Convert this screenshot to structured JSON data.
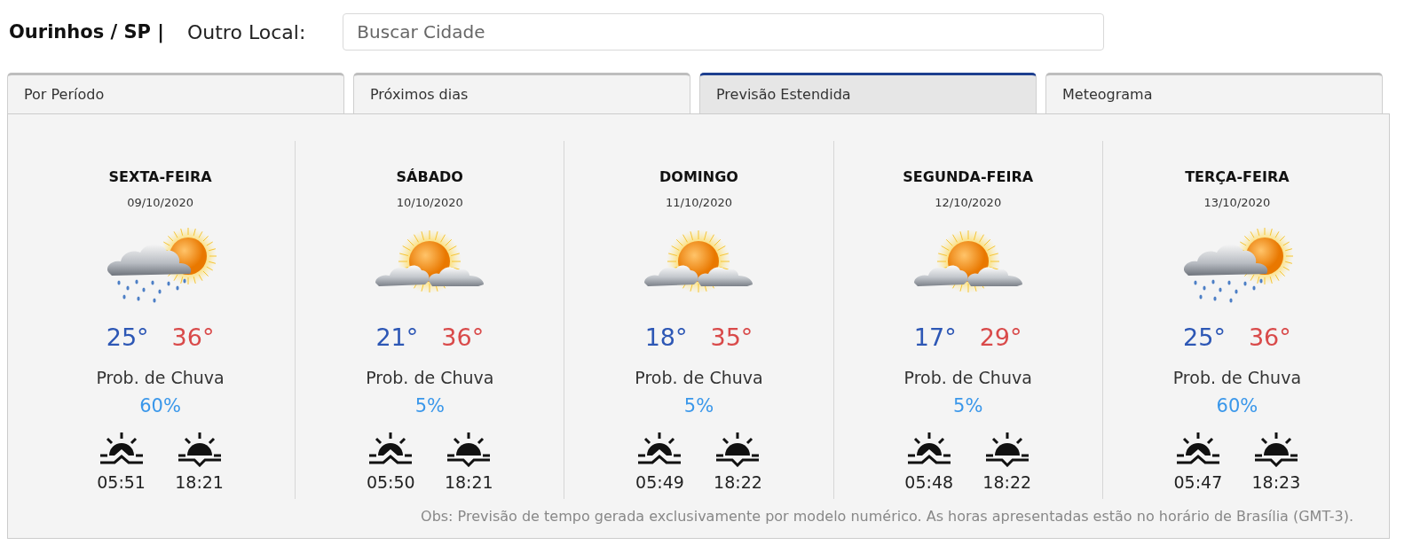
{
  "header": {
    "title": "Ourinhos / SP |",
    "label": "Outro Local:"
  },
  "search": {
    "placeholder": "Buscar Cidade"
  },
  "tabs": [
    {
      "label": "Por Período",
      "selected": false
    },
    {
      "label": "Próximos dias",
      "selected": false
    },
    {
      "label": "Previsão Estendida",
      "selected": true
    },
    {
      "label": "Meteograma",
      "selected": false
    }
  ],
  "days": [
    {
      "name": "SEXTA-FEIRA",
      "date": "09/10/2020",
      "kind": "rain",
      "min": "25°",
      "max": "36°",
      "rain_label": "Prob. de Chuva",
      "rain_chance": "60%",
      "sunrise": "05:51",
      "sunset": "18:21"
    },
    {
      "name": "SÁBADO",
      "date": "10/10/2020",
      "kind": "cloudy",
      "min": "21°",
      "max": "36°",
      "rain_label": "Prob. de Chuva",
      "rain_chance": "5%",
      "sunrise": "05:50",
      "sunset": "18:21"
    },
    {
      "name": "DOMINGO",
      "date": "11/10/2020",
      "kind": "cloudy",
      "min": "18°",
      "max": "35°",
      "rain_label": "Prob. de Chuva",
      "rain_chance": "5%",
      "sunrise": "05:49",
      "sunset": "18:22"
    },
    {
      "name": "SEGUNDA-FEIRA",
      "date": "12/10/2020",
      "kind": "cloudy",
      "min": "17°",
      "max": "29°",
      "rain_label": "Prob. de Chuva",
      "rain_chance": "5%",
      "sunrise": "05:48",
      "sunset": "18:22"
    },
    {
      "name": "TERÇA-FEIRA",
      "date": "13/10/2020",
      "kind": "rain",
      "min": "25°",
      "max": "36°",
      "rain_label": "Prob. de Chuva",
      "rain_chance": "60%",
      "sunrise": "05:47",
      "sunset": "18:23"
    }
  ],
  "note": "Obs: Previsão de tempo gerada exclusivamente por modelo numérico. As horas apresentadas estão no horário de Brasília (GMT-3)."
}
